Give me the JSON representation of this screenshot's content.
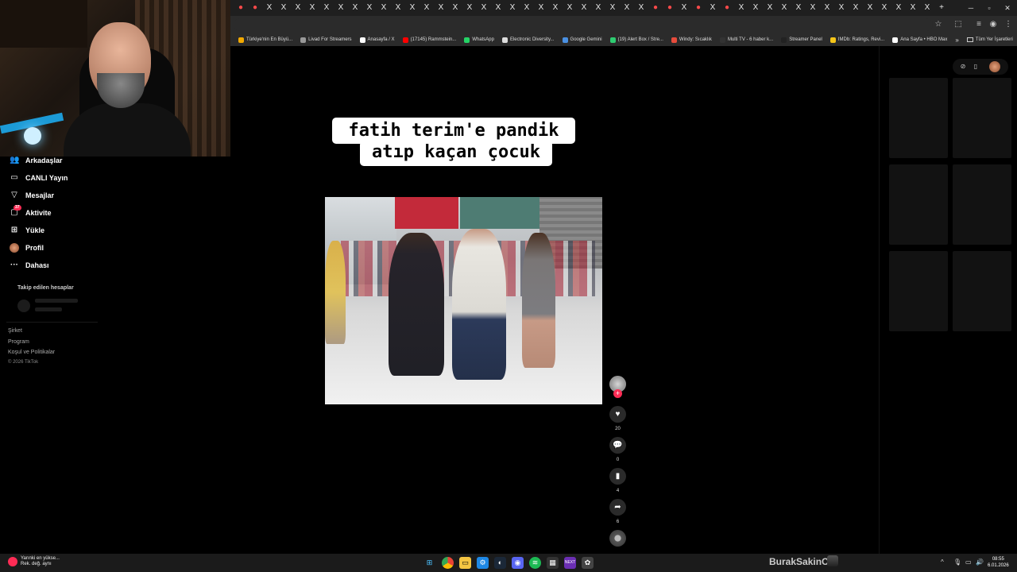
{
  "browser": {
    "tabs": [
      {
        "icon": "tiktok",
        "color": "red"
      },
      {
        "icon": "youtube",
        "color": "red"
      },
      {
        "icon": "x"
      },
      {
        "icon": "x"
      },
      {
        "icon": "x"
      },
      {
        "icon": "x"
      },
      {
        "icon": "x"
      },
      {
        "icon": "x"
      },
      {
        "icon": "x"
      },
      {
        "icon": "x"
      },
      {
        "icon": "x"
      },
      {
        "icon": "x"
      },
      {
        "icon": "x"
      },
      {
        "icon": "x"
      },
      {
        "icon": "x"
      },
      {
        "icon": "x"
      },
      {
        "icon": "x"
      },
      {
        "icon": "x"
      },
      {
        "icon": "x"
      },
      {
        "icon": "x"
      },
      {
        "icon": "x"
      },
      {
        "icon": "x"
      },
      {
        "icon": "x"
      },
      {
        "icon": "x"
      },
      {
        "icon": "x"
      },
      {
        "icon": "x"
      },
      {
        "icon": "x"
      },
      {
        "icon": "x"
      },
      {
        "icon": "x"
      },
      {
        "icon": "youtube",
        "color": "red"
      },
      {
        "icon": "youtube",
        "color": "red"
      },
      {
        "icon": "x"
      },
      {
        "icon": "youtube",
        "color": "red"
      },
      {
        "icon": "x"
      },
      {
        "icon": "youtube",
        "color": "red"
      },
      {
        "icon": "x"
      },
      {
        "icon": "x"
      },
      {
        "icon": "x"
      },
      {
        "icon": "x"
      },
      {
        "icon": "x"
      },
      {
        "icon": "x"
      },
      {
        "icon": "x"
      },
      {
        "icon": "x"
      },
      {
        "icon": "x"
      },
      {
        "icon": "x"
      },
      {
        "icon": "x"
      },
      {
        "icon": "x"
      },
      {
        "icon": "x"
      },
      {
        "icon": "x"
      }
    ],
    "new_tab": "+",
    "bookmarks": [
      {
        "label": "Türkiye'nin En Büyü...",
        "color": "#f2a900"
      },
      {
        "label": "Livad For Streamers",
        "color": "#999999"
      },
      {
        "label": "Anasayfa / X",
        "color": "#ffffff"
      },
      {
        "label": "(17145) Rammstein...",
        "color": "#ff0000"
      },
      {
        "label": "WhatsApp",
        "color": "#25d366"
      },
      {
        "label": "Electronic Diversity...",
        "color": "#dddddd"
      },
      {
        "label": "Google Gemini",
        "color": "#4a90e2"
      },
      {
        "label": "(19) Alert Box / Stre...",
        "color": "#2ecc71"
      },
      {
        "label": "Windy: Sıcaklık",
        "color": "#e74c3c"
      },
      {
        "label": "Multi TV - 6 haber k...",
        "color": "#333333"
      },
      {
        "label": "Streamer Panel",
        "color": "#222222"
      },
      {
        "label": "IMDb: Ratings, Revi...",
        "color": "#f5c518"
      },
      {
        "label": "Ana Sayfa • HBO Max",
        "color": "#ffffff"
      }
    ],
    "bookmarks_overflow": "»",
    "bookmarks_folder": "Tüm Yer İşaretleri"
  },
  "sidebar": {
    "items": [
      {
        "icon": "friends-icon",
        "glyph": "👥",
        "label": "Arkadaşlar"
      },
      {
        "icon": "live-icon",
        "glyph": "▭",
        "label": "CANLI Yayın"
      },
      {
        "icon": "messages-icon",
        "glyph": "▽",
        "label": "Mesajlar"
      },
      {
        "icon": "activity-icon",
        "glyph": "▢",
        "label": "Aktivite",
        "badge": "37"
      },
      {
        "icon": "upload-icon",
        "glyph": "⊞",
        "label": "Yükle"
      },
      {
        "icon": "profile-icon",
        "glyph": "",
        "label": "Profil"
      },
      {
        "icon": "more-icon",
        "glyph": "···",
        "label": "Dahası"
      }
    ],
    "following_title": "Takip edilen hesaplar",
    "footer": {
      "company": "Şirket",
      "program": "Program",
      "terms": "Koşul ve Politikalar",
      "copyright": "© 2026 TikTok"
    }
  },
  "video": {
    "caption_line1": "fatih terim'e pandik",
    "caption_line2": "atıp kaçan çocuk"
  },
  "actions": {
    "likes": "20",
    "comments": "0",
    "saves": "4",
    "shares": "6"
  },
  "taskbar": {
    "weather_line1": "Yarınki en yükse...",
    "weather_line2": "Rek. değ. aynı",
    "streamer_name": "BurakSakinOl",
    "time": "08:55",
    "date": "6.01.2026"
  },
  "colors": {
    "accent": "#fe2c55",
    "background": "#000000"
  }
}
